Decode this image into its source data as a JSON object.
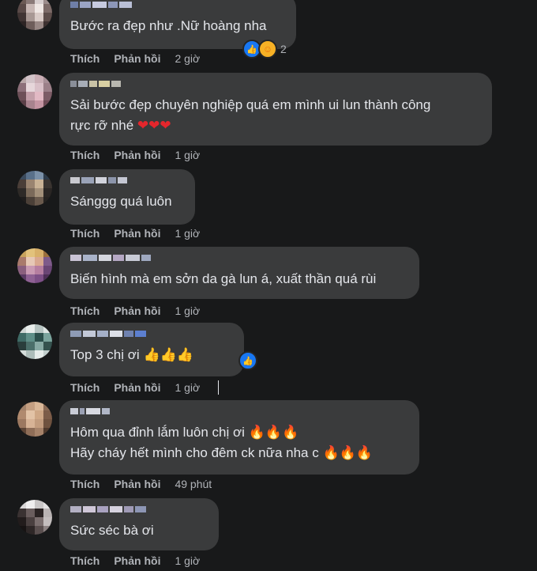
{
  "actions": {
    "like": "Thích",
    "reply": "Phản hồi"
  },
  "comments": [
    {
      "text": "Bước ra đẹp như .Nữ hoàng nha",
      "time": "2 giờ",
      "reactions_count": "2"
    },
    {
      "text": "Sải bước đẹp chuyên nghiệp quá em mình ui lun thành công\nrực rỡ nhé",
      "emoji": "❤❤❤",
      "time": "1 giờ"
    },
    {
      "text": "Sánggg quá luôn",
      "time": "1 giờ"
    },
    {
      "text": "Biến hình mà em sởn da gà lun á, xuất thần quá rùi",
      "time": "1 giờ"
    },
    {
      "text": "Top 3 chị ơi",
      "emoji": "👍👍👍",
      "time": "1 giờ"
    },
    {
      "text_line1": "Hôm qua đỉnh lắm luôn chị ơi",
      "emoji1": "🔥🔥🔥",
      "text_line2": "Hãy cháy hết mình cho đêm ck nữa nha c",
      "emoji2": "🔥🔥🔥",
      "time": "49 phút"
    },
    {
      "text": "Sức séc bà ơi",
      "time": "1 giờ"
    }
  ],
  "colors": {
    "background": "#18191a",
    "bubble": "#3a3b3c",
    "text": "#e4e6eb",
    "muted": "#b0b3b8",
    "like": "#1877f2"
  }
}
